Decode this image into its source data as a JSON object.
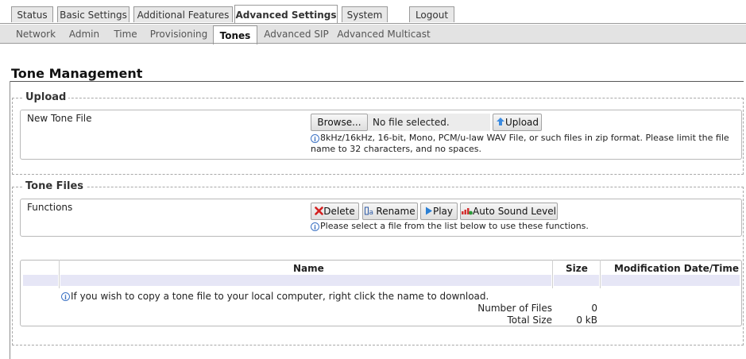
{
  "top_tabs": [
    {
      "label": "Status",
      "active": false
    },
    {
      "label": "Basic Settings",
      "active": false
    },
    {
      "label": "Additional Features",
      "active": false
    },
    {
      "label": "Advanced Settings",
      "active": true
    },
    {
      "label": "System",
      "active": false
    },
    {
      "label": "Logout",
      "active": false
    }
  ],
  "sub_tabs": [
    {
      "label": "Network",
      "active": false
    },
    {
      "label": "Admin",
      "active": false
    },
    {
      "label": "Time",
      "active": false
    },
    {
      "label": "Provisioning",
      "active": false
    },
    {
      "label": "Tones",
      "active": true
    },
    {
      "label": "Advanced SIP",
      "active": false
    },
    {
      "label": "Advanced Multicast",
      "active": false
    }
  ],
  "page": {
    "title": "Tone Management"
  },
  "upload": {
    "legend": "Upload",
    "row_label": "New Tone File",
    "browse_label": "Browse...",
    "file_status": "No file selected.",
    "upload_label": "Upload",
    "hint": "8kHz/16kHz, 16-bit, Mono, PCM/u-law WAV File, or such files in zip format. Please limit the file name to 32 characters, and no spaces."
  },
  "tone_files": {
    "legend": "Tone Files",
    "row_label": "Functions",
    "buttons": {
      "delete": "Delete",
      "rename": "Rename",
      "play": "Play",
      "auto_sound": "Auto Sound Level"
    },
    "functions_hint": "Please select a file from the list below to use these functions.",
    "table": {
      "columns": [
        "Name",
        "Size",
        "Modification Date/Time"
      ],
      "rows": []
    },
    "download_hint": "If you wish to copy a tone file to your local computer, right click the name to download.",
    "summary": {
      "count_label": "Number of Files",
      "count_value": "0",
      "size_label": "Total Size",
      "size_value": "0 kB"
    }
  },
  "colors": {
    "tab_border": "#9a9a9a",
    "subbar_bg": "#e3e3e3",
    "info_blue": "#3d73c4",
    "delete_red": "#d42020",
    "play_blue": "#2a7fd4",
    "table_row_bg": "#e6e6f6"
  },
  "icons": {
    "upload": "upload-arrow-icon",
    "delete": "red-x-icon",
    "rename": "rename-icon",
    "play": "play-triangle-icon",
    "auto_sound": "sound-level-icon",
    "info": "info-icon"
  }
}
